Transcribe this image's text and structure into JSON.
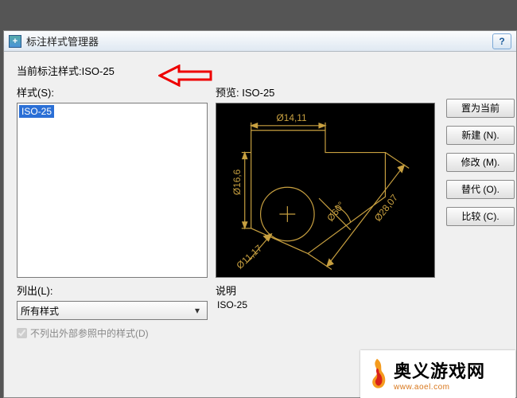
{
  "title": "标注样式管理器",
  "help_label": "?",
  "current_style_label": "当前标注样式:",
  "current_style_value": "ISO-25",
  "styles_label": "样式(S):",
  "styles": [
    "ISO-25"
  ],
  "preview_label": "预览: ISO-25",
  "preview_dims": {
    "d1": "14,11",
    "d2": "16,6",
    "d3": "11,17",
    "ang": "60°",
    "d4": "28,07"
  },
  "buttons": {
    "set_current": "置为当前",
    "new": "新建 (N).",
    "modify": "修改 (M).",
    "override": "替代 (O).",
    "compare": "比较 (C)."
  },
  "list_label": "列出(L):",
  "list_value": "所有样式",
  "checkbox_label": "不列出外部参照中的样式(D)",
  "desc_label": "说明",
  "desc_value": "ISO-25",
  "watermark": {
    "cn": "奥义游戏网",
    "url": "www.aoel.com"
  }
}
